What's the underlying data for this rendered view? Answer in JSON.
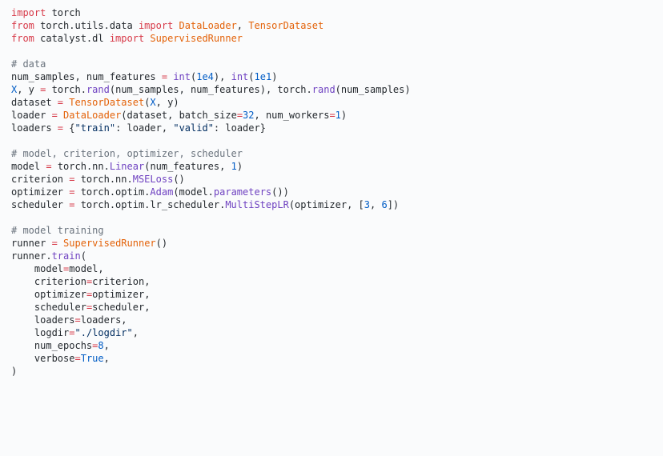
{
  "lines": [
    [
      [
        "kw",
        "import"
      ],
      [
        "id",
        " torch"
      ]
    ],
    [
      [
        "kw",
        "from"
      ],
      [
        "id",
        " torch.utils.data "
      ],
      [
        "kw",
        "import"
      ],
      [
        "id",
        " "
      ],
      [
        "cls",
        "DataLoader"
      ],
      [
        "pun",
        ", "
      ],
      [
        "cls",
        "TensorDataset"
      ]
    ],
    [
      [
        "kw",
        "from"
      ],
      [
        "id",
        " catalyst.dl "
      ],
      [
        "kw",
        "import"
      ],
      [
        "id",
        " "
      ],
      [
        "cls",
        "SupervisedRunner"
      ]
    ],
    [],
    [
      [
        "cmt",
        "# data"
      ]
    ],
    [
      [
        "id",
        "num_samples, num_features "
      ],
      [
        "op",
        "="
      ],
      [
        "id",
        " "
      ],
      [
        "fn",
        "int"
      ],
      [
        "pun",
        "("
      ],
      [
        "num",
        "1e4"
      ],
      [
        "pun",
        "), "
      ],
      [
        "fn",
        "int"
      ],
      [
        "pun",
        "("
      ],
      [
        "num",
        "1e1"
      ],
      [
        "pun",
        ")"
      ]
    ],
    [
      [
        "bl",
        "X"
      ],
      [
        "id",
        ", y "
      ],
      [
        "op",
        "="
      ],
      [
        "id",
        " torch."
      ],
      [
        "fn",
        "rand"
      ],
      [
        "pun",
        "("
      ],
      [
        "id",
        "num_samples, num_features"
      ],
      [
        "pun",
        "), "
      ],
      [
        "id",
        "torch."
      ],
      [
        "fn",
        "rand"
      ],
      [
        "pun",
        "("
      ],
      [
        "id",
        "num_samples"
      ],
      [
        "pun",
        ")"
      ]
    ],
    [
      [
        "id",
        "dataset "
      ],
      [
        "op",
        "="
      ],
      [
        "id",
        " "
      ],
      [
        "cls",
        "TensorDataset"
      ],
      [
        "pun",
        "("
      ],
      [
        "bl",
        "X"
      ],
      [
        "id",
        ", y"
      ],
      [
        "pun",
        ")"
      ]
    ],
    [
      [
        "id",
        "loader "
      ],
      [
        "op",
        "="
      ],
      [
        "id",
        " "
      ],
      [
        "cls",
        "DataLoader"
      ],
      [
        "pun",
        "("
      ],
      [
        "id",
        "dataset, "
      ],
      [
        "arg",
        "batch_size"
      ],
      [
        "op",
        "="
      ],
      [
        "num",
        "32"
      ],
      [
        "id",
        ", "
      ],
      [
        "arg",
        "num_workers"
      ],
      [
        "op",
        "="
      ],
      [
        "num",
        "1"
      ],
      [
        "pun",
        ")"
      ]
    ],
    [
      [
        "id",
        "loaders "
      ],
      [
        "op",
        "="
      ],
      [
        "id",
        " "
      ],
      [
        "pun",
        "{"
      ],
      [
        "str",
        "\"train\""
      ],
      [
        "pun",
        ": "
      ],
      [
        "id",
        "loader"
      ],
      [
        "pun",
        ", "
      ],
      [
        "str",
        "\"valid\""
      ],
      [
        "pun",
        ": "
      ],
      [
        "id",
        "loader"
      ],
      [
        "pun",
        "}"
      ]
    ],
    [],
    [
      [
        "cmt",
        "# model, criterion, optimizer, scheduler"
      ]
    ],
    [
      [
        "id",
        "model "
      ],
      [
        "op",
        "="
      ],
      [
        "id",
        " torch.nn."
      ],
      [
        "fn",
        "Linear"
      ],
      [
        "pun",
        "("
      ],
      [
        "id",
        "num_features, "
      ],
      [
        "num",
        "1"
      ],
      [
        "pun",
        ")"
      ]
    ],
    [
      [
        "id",
        "criterion "
      ],
      [
        "op",
        "="
      ],
      [
        "id",
        " torch.nn."
      ],
      [
        "fn",
        "MSELoss"
      ],
      [
        "pun",
        "()"
      ]
    ],
    [
      [
        "id",
        "optimizer "
      ],
      [
        "op",
        "="
      ],
      [
        "id",
        " torch.optim."
      ],
      [
        "fn",
        "Adam"
      ],
      [
        "pun",
        "("
      ],
      [
        "id",
        "model."
      ],
      [
        "fn",
        "parameters"
      ],
      [
        "pun",
        "())"
      ]
    ],
    [
      [
        "id",
        "scheduler "
      ],
      [
        "op",
        "="
      ],
      [
        "id",
        " torch.optim.lr_scheduler."
      ],
      [
        "fn",
        "MultiStepLR"
      ],
      [
        "pun",
        "("
      ],
      [
        "id",
        "optimizer, "
      ],
      [
        "pun",
        "["
      ],
      [
        "num",
        "3"
      ],
      [
        "pun",
        ", "
      ],
      [
        "num",
        "6"
      ],
      [
        "pun",
        "])"
      ]
    ],
    [],
    [
      [
        "cmt",
        "# model training"
      ]
    ],
    [
      [
        "id",
        "runner "
      ],
      [
        "op",
        "="
      ],
      [
        "id",
        " "
      ],
      [
        "cls",
        "SupervisedRunner"
      ],
      [
        "pun",
        "()"
      ]
    ],
    [
      [
        "id",
        "runner."
      ],
      [
        "fn",
        "train"
      ],
      [
        "pun",
        "("
      ]
    ],
    [
      [
        "id",
        "    "
      ],
      [
        "arg",
        "model"
      ],
      [
        "op",
        "="
      ],
      [
        "id",
        "model,"
      ]
    ],
    [
      [
        "id",
        "    "
      ],
      [
        "arg",
        "criterion"
      ],
      [
        "op",
        "="
      ],
      [
        "id",
        "criterion,"
      ]
    ],
    [
      [
        "id",
        "    "
      ],
      [
        "arg",
        "optimizer"
      ],
      [
        "op",
        "="
      ],
      [
        "id",
        "optimizer,"
      ]
    ],
    [
      [
        "id",
        "    "
      ],
      [
        "arg",
        "scheduler"
      ],
      [
        "op",
        "="
      ],
      [
        "id",
        "scheduler,"
      ]
    ],
    [
      [
        "id",
        "    "
      ],
      [
        "arg",
        "loaders"
      ],
      [
        "op",
        "="
      ],
      [
        "id",
        "loaders,"
      ]
    ],
    [
      [
        "id",
        "    "
      ],
      [
        "arg",
        "logdir"
      ],
      [
        "op",
        "="
      ],
      [
        "str",
        "\"./logdir\""
      ],
      [
        "pun",
        ","
      ]
    ],
    [
      [
        "id",
        "    "
      ],
      [
        "arg",
        "num_epochs"
      ],
      [
        "op",
        "="
      ],
      [
        "num",
        "8"
      ],
      [
        "pun",
        ","
      ]
    ],
    [
      [
        "id",
        "    "
      ],
      [
        "arg",
        "verbose"
      ],
      [
        "op",
        "="
      ],
      [
        "num",
        "True"
      ],
      [
        "pun",
        ","
      ]
    ],
    [
      [
        "pun",
        ")"
      ]
    ]
  ]
}
